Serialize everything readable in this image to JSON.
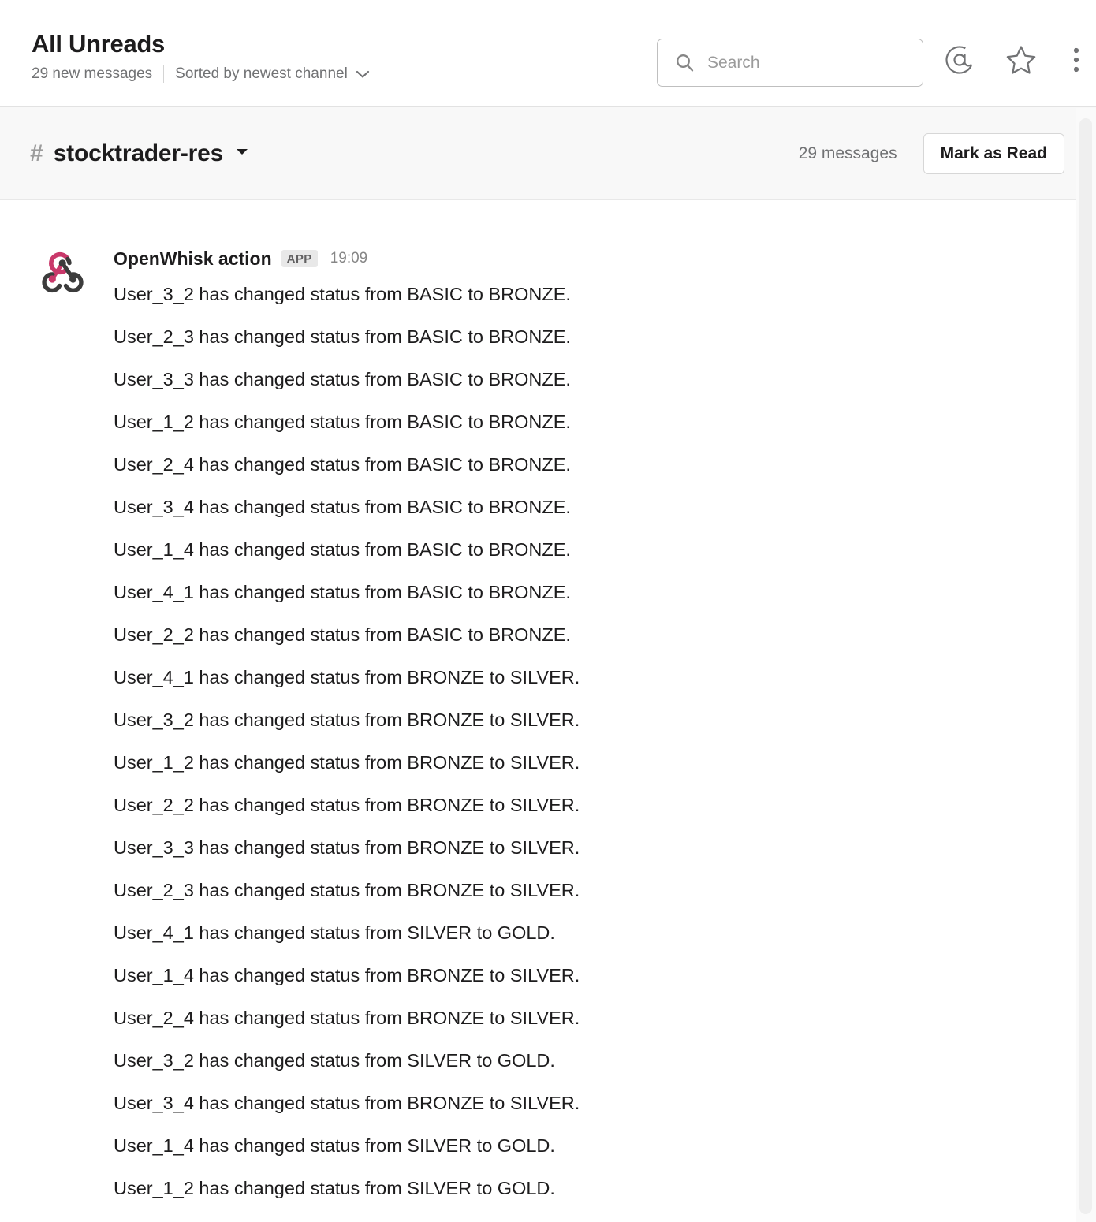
{
  "header": {
    "title": "All Unreads",
    "new_messages": "29 new messages",
    "sort_label": "Sorted by newest channel",
    "search": {
      "placeholder": "Search",
      "value": ""
    },
    "icons": {
      "search": "search-icon",
      "mentions": "at-mention-icon",
      "starred": "star-icon",
      "more": "more-options-icon",
      "sort_chevron": "chevron-down-icon"
    }
  },
  "channel": {
    "hash": "#",
    "name": "stocktrader-res",
    "chevron": "chevron-down-icon",
    "message_count": "29 messages",
    "mark_as_read_label": "Mark as Read"
  },
  "message_group": {
    "author": "OpenWhisk action",
    "badge": "APP",
    "timestamp": "19:09",
    "avatar_icon": "openwhisk-logo-icon",
    "avatar_colors": {
      "pink": "#C9386A",
      "dark": "#3C3C3C"
    },
    "lines": [
      "User_3_2 has changed status from BASIC to BRONZE.",
      "User_2_3 has changed status from BASIC to BRONZE.",
      "User_3_3 has changed status from BASIC to BRONZE.",
      "User_1_2 has changed status from BASIC to BRONZE.",
      "User_2_4 has changed status from BASIC to BRONZE.",
      "User_3_4 has changed status from BASIC to BRONZE.",
      "User_1_4 has changed status from BASIC to BRONZE.",
      "User_4_1 has changed status from BASIC to BRONZE.",
      "User_2_2 has changed status from BASIC to BRONZE.",
      "User_4_1 has changed status from BRONZE to SILVER.",
      "User_3_2 has changed status from BRONZE to SILVER.",
      "User_1_2 has changed status from BRONZE to SILVER.",
      "User_2_2 has changed status from BRONZE to SILVER.",
      "User_3_3 has changed status from BRONZE to SILVER.",
      "User_2_3 has changed status from BRONZE to SILVER.",
      "User_4_1 has changed status from SILVER to GOLD.",
      "User_1_4 has changed status from BRONZE to SILVER.",
      "User_2_4 has changed status from BRONZE to SILVER.",
      "User_3_2 has changed status from SILVER to GOLD.",
      "User_3_4 has changed status from BRONZE to SILVER.",
      "User_1_4 has changed status from SILVER to GOLD.",
      "User_1_2 has changed status from SILVER to GOLD."
    ]
  },
  "colors": {
    "text_primary": "#1d1c1d",
    "text_secondary": "#717274",
    "channel_bar_bg": "#f8f8f8",
    "border": "#e2e2e2"
  }
}
